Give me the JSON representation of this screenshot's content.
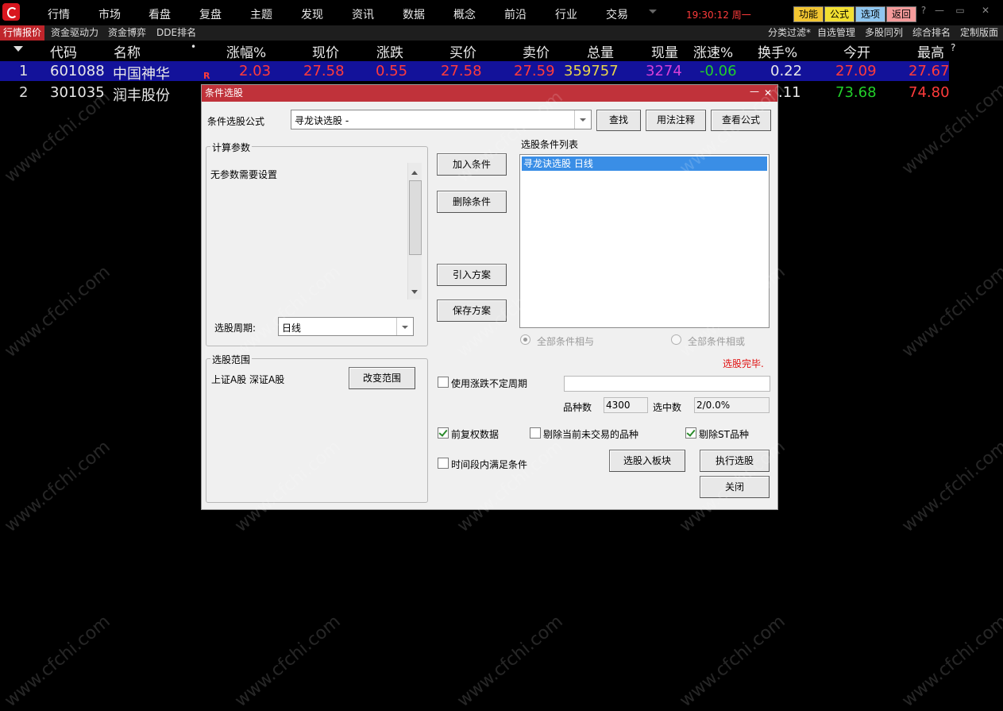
{
  "menu": [
    "行情",
    "市场",
    "看盘",
    "复盘",
    "主题",
    "发现",
    "资讯",
    "数据",
    "概念",
    "前沿",
    "行业",
    "交易"
  ],
  "clock": "19:30:12 周一",
  "top_buttons": {
    "func": "功能",
    "formula": "公式",
    "options": "选项",
    "back": "返回"
  },
  "window_controls": {
    "help": "?",
    "minimize": "—",
    "restore": "▭",
    "close": "✕"
  },
  "subtabs": [
    "行情报价",
    "资金驱动力",
    "资金博弈",
    "DDE排名"
  ],
  "subright": [
    "分类过滤*",
    "自选管理",
    "多股同列",
    "综合排名",
    "定制版面"
  ],
  "table": {
    "headers": {
      "code": "代码",
      "name": "名称",
      "dot": "•",
      "pct": "涨幅%",
      "price": "现价",
      "chg": "涨跌",
      "bid": "买价",
      "ask": "卖价",
      "vol": "总量",
      "curvol": "现量",
      "speed": "涨速%",
      "turn": "换手%",
      "open": "今开",
      "high": "最高",
      "q": "?"
    },
    "rows": [
      {
        "no": "1",
        "code": "601088",
        "name": "中国神华",
        "flag": "R",
        "pct": "2.03",
        "price": "27.58",
        "chg": "0.55",
        "bid": "27.58",
        "ask": "27.59",
        "vol": "359757",
        "curvol": "3274",
        "speed": "-0.06",
        "turn": "0.22",
        "open": "27.09",
        "high": "27.67"
      },
      {
        "no": "2",
        "code": "301035",
        "name": "润丰股份",
        "turn": ".11",
        "open": "73.68",
        "high": "74.80"
      }
    ]
  },
  "dialog": {
    "title": "条件选股",
    "minimize": "—",
    "close": "✕",
    "formula_label": "条件选股公式",
    "formula_value": "寻龙诀选股   -",
    "btn_find": "查找",
    "btn_usage": "用法注释",
    "btn_view": "查看公式",
    "params_legend": "计算参数",
    "params_text": "无参数需要设置",
    "period_label": "选股周期:",
    "period_value": "日线",
    "btn_add": "加入条件",
    "btn_delete": "删除条件",
    "btn_import": "引入方案",
    "btn_save": "保存方案",
    "list_label": "选股条件列表",
    "list_items": [
      "寻龙诀选股  日线"
    ],
    "radio_and": "全部条件相与",
    "radio_or": "全部条件相或",
    "status": "选股完毕.",
    "range_legend": "选股范围",
    "range_text": "上证A股 深证A股",
    "btn_change_range": "改变范围",
    "cb_uncertain_period": "使用涨跌不定周期",
    "count_label": "品种数",
    "count_value": "4300",
    "selected_label": "选中数",
    "selected_value": "2/0.0%",
    "cb_adjusted": "前复权数据",
    "cb_exclude_untraded": "剔除当前未交易的品种",
    "cb_exclude_st": "剔除ST品种",
    "cb_period_satisfy": "时间段内满足条件",
    "btn_to_block": "选股入板块",
    "btn_execute": "执行选股",
    "btn_close": "关闭"
  },
  "watermark": "www.cfchi.com",
  "colors": {
    "up": "#ff3b3b",
    "down": "#22d02a",
    "volume": "#e8d44a",
    "curvol": "#d63fd6",
    "row_select": "#13129a",
    "accent": "#c0323a"
  }
}
